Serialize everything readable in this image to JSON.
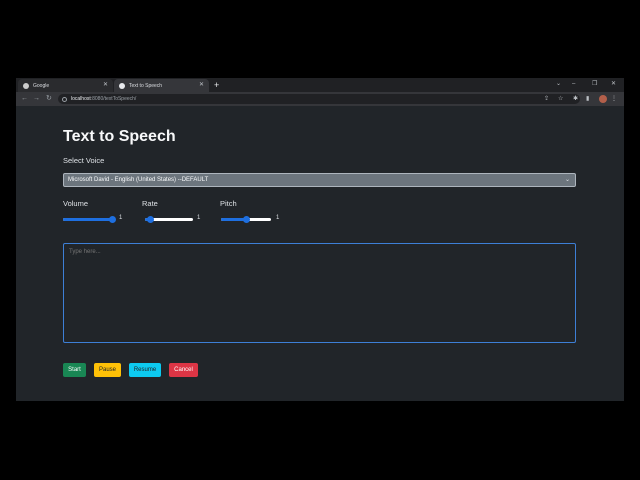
{
  "browser": {
    "tabs": [
      {
        "title": "Google"
      },
      {
        "title": "Text to Speech"
      }
    ],
    "new_tab": "+",
    "url_host": "localhost",
    "url_path": ":8080/textToSpeech/"
  },
  "page": {
    "title": "Text to Speech",
    "voice_label": "Select Voice",
    "voice_selected": "Microsoft David - English (United States) --DEFAULT",
    "volume": {
      "label": "Volume",
      "value": "1",
      "fraction": 1.0
    },
    "rate": {
      "label": "Rate",
      "value": "1",
      "fraction": 0.1
    },
    "pitch": {
      "label": "Pitch",
      "value": "1",
      "fraction": 0.5
    },
    "textarea_placeholder": "Type here...",
    "buttons": {
      "start": "Start",
      "pause": "Pause",
      "resume": "Resume",
      "cancel": "Cancel"
    }
  },
  "colors": {
    "page_bg": "#212529",
    "accent": "#1e6fe0",
    "start": "#198754",
    "pause": "#ffc107",
    "resume": "#0dcaf0",
    "cancel": "#dc3545"
  }
}
